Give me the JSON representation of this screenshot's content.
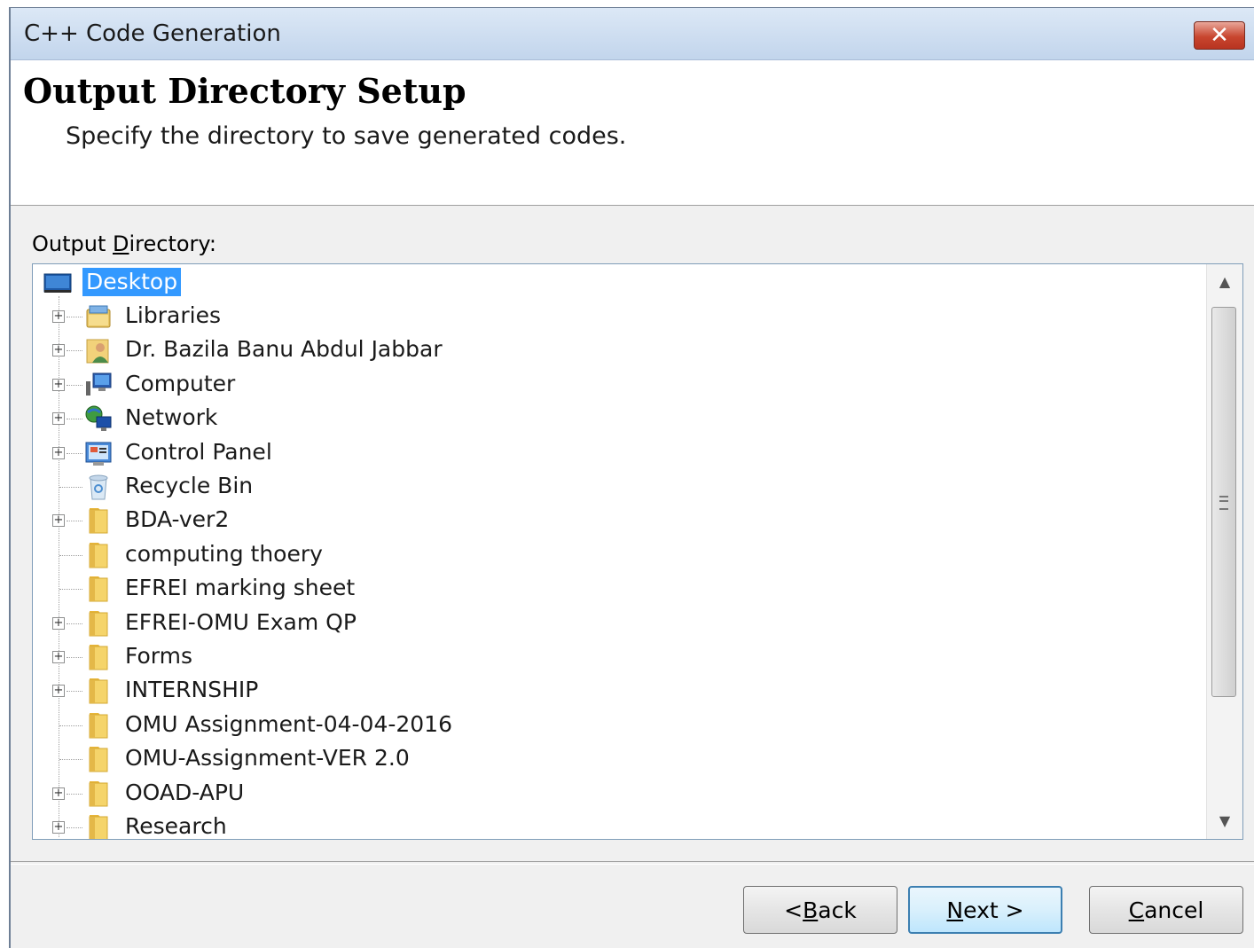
{
  "window": {
    "title": "C++ Code Generation",
    "close_label": "✕"
  },
  "header": {
    "title": "Output Directory Setup",
    "subtitle": "Specify the directory to save generated codes."
  },
  "output_directory": {
    "label_prefix": "Output ",
    "label_mnemonic": "D",
    "label_suffix": "irectory:"
  },
  "tree": {
    "root": {
      "label": "Desktop",
      "icon": "desktop-icon",
      "selected": true
    },
    "items": [
      {
        "label": "Libraries",
        "icon": "libraries-icon",
        "expandable": true
      },
      {
        "label": "Dr. Bazila Banu Abdul Jabbar",
        "icon": "user-folder-icon",
        "expandable": true
      },
      {
        "label": "Computer",
        "icon": "computer-icon",
        "expandable": true
      },
      {
        "label": "Network",
        "icon": "network-icon",
        "expandable": true
      },
      {
        "label": "Control Panel",
        "icon": "control-panel-icon",
        "expandable": true
      },
      {
        "label": "Recycle Bin",
        "icon": "recycle-bin-icon",
        "expandable": false
      },
      {
        "label": "BDA-ver2",
        "icon": "folder-icon",
        "expandable": true
      },
      {
        "label": "computing thoery",
        "icon": "folder-icon",
        "expandable": false
      },
      {
        "label": "EFREI marking sheet",
        "icon": "folder-icon",
        "expandable": false
      },
      {
        "label": "EFREI-OMU Exam QP",
        "icon": "folder-icon",
        "expandable": true
      },
      {
        "label": "Forms",
        "icon": "folder-icon",
        "expandable": true
      },
      {
        "label": "INTERNSHIP",
        "icon": "folder-icon",
        "expandable": true
      },
      {
        "label": "OMU Assignment-04-04-2016",
        "icon": "folder-icon",
        "expandable": false
      },
      {
        "label": "OMU-Assignment-VER 2.0",
        "icon": "folder-icon",
        "expandable": false
      },
      {
        "label": "OOAD-APU",
        "icon": "folder-icon",
        "expandable": true
      },
      {
        "label": "Research",
        "icon": "folder-icon",
        "expandable": true
      }
    ]
  },
  "buttons": {
    "back": {
      "prefix": "< ",
      "mnemonic": "B",
      "suffix": "ack"
    },
    "next": {
      "prefix": "",
      "mnemonic": "N",
      "suffix": "ext >"
    },
    "cancel": {
      "prefix": "",
      "mnemonic": "C",
      "suffix": "ancel"
    }
  },
  "colors": {
    "selection": "#3399ff",
    "folder": "#f2c94c",
    "titlebar": "#c2d5ec"
  }
}
